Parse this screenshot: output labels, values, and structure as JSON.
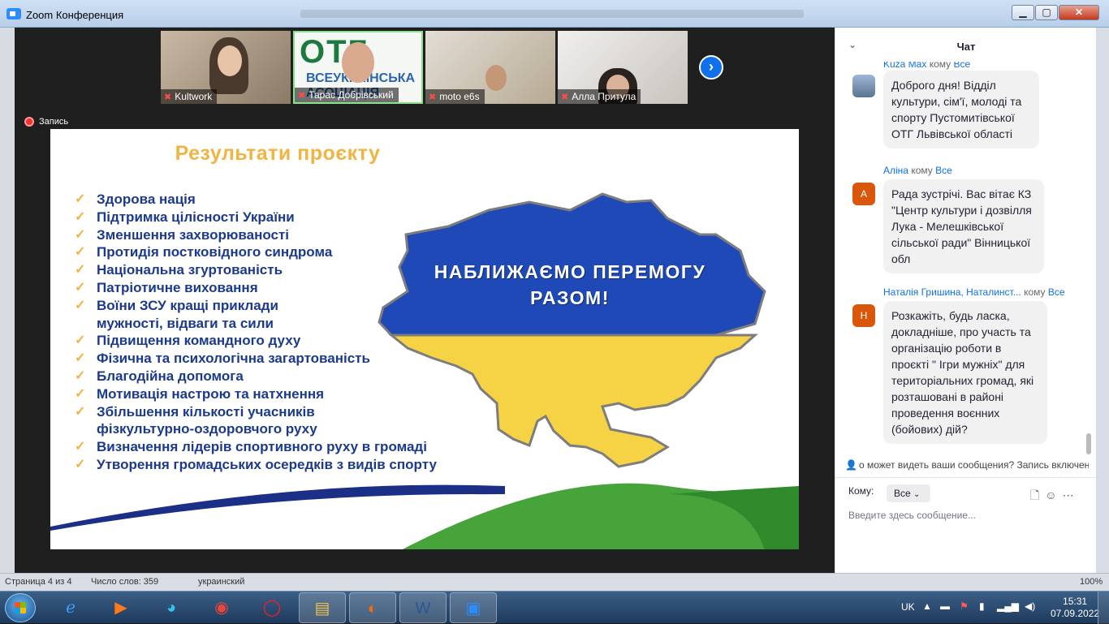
{
  "window": {
    "title": "Zoom Конференция",
    "min_symbol": "▁",
    "max_symbol": "▢",
    "close_symbol": "✕"
  },
  "participants": [
    {
      "name": "Kultwork"
    },
    {
      "name": "Тарас Добрівський",
      "logo_main": "ОТГ",
      "logo_sub": "ВСЕУКРАЇНСЬКА\nАСОЦІАЦІЯ"
    },
    {
      "name": "moto e6s"
    },
    {
      "name": "Алла Притула"
    }
  ],
  "next_symbol": "›",
  "recording": {
    "label": "Запись"
  },
  "slide": {
    "title": "Результати проєкту",
    "items": [
      "Здорова нація",
      "Підтримка цілісності України",
      "Зменшення захворюваності",
      "Протидія постковідного синдрома",
      "Національна згуртованість",
      "Патріотичне виховання",
      "Воїни ЗСУ кращі приклади",
      "мужності, відваги та сили",
      "Підвищення командного духу",
      "Фізична та психологічна загартованість",
      "Благодійна допомога",
      "Мотивація настрою та натхнення",
      "Збільшення кількості учасників",
      "фізкультурно-оздоровчого руху",
      "Визначення лідерів спортивного руху в громаді",
      "Утворення громадських осередків з видів спорту"
    ],
    "map_text_line1": "НАБЛИЖАЄМО ПЕРЕМОГУ",
    "map_text_line2": "РАЗОМ!",
    "colors": {
      "blue": "#1f49b6",
      "yellow": "#f6d245",
      "navy": "#1c3a8c",
      "green": "#46a43a"
    }
  },
  "chat": {
    "title": "Чат",
    "messages": [
      {
        "sender": "Kuza Max",
        "to_word": "кому",
        "recipient": "Все",
        "avatar_letter": "",
        "text": "Доброго дня! Відділ культури, сім'ї, молоді та спорту Пустомитівської ОТГ Львівської області"
      },
      {
        "sender": "Аліна",
        "to_word": "кому",
        "recipient": "Все",
        "avatar_letter": "A",
        "text": "Рада зустрічі. Вас вітає КЗ \"Центр культури і дозвілля Лука - Мелешківської сільської ради\" Вінницької обл"
      },
      {
        "sender": "Наталія Гришина, Наталинст...",
        "to_word": "кому",
        "recipient": "Все",
        "avatar_letter": "Н",
        "text": "Розкажіть, будь ласка, докладніше, про участь та організацію роботи в проєкті \" Ігри мужніх\" для територіальних громад, які розташовані в районі проведення воєнних (бойових) дій?"
      }
    ],
    "privacy_notice": "о может видеть ваши сообщения? Запись включена",
    "to_label": "Кому:",
    "to_value": "Все",
    "input_placeholder": "Введите здесь сообщение..."
  },
  "statusbar": {
    "page": "Страница 4 из 4",
    "words": "Число слов: 359",
    "lang": "украинский",
    "zoom": "100%"
  },
  "taskbar": {
    "lang": "UK",
    "time": "15:31",
    "date": "07.09.2022"
  }
}
